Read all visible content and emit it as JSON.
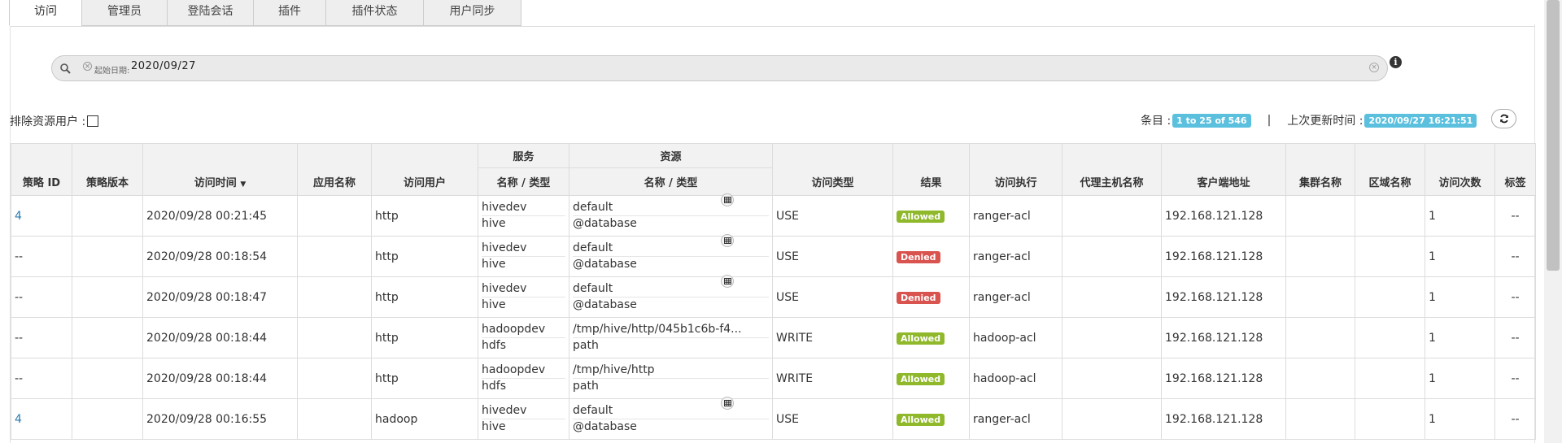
{
  "tabs": [
    "访问",
    "管理员",
    "登陆会话",
    "插件",
    "插件状态",
    "用户同步"
  ],
  "search": {
    "chip_label": "起始日期:",
    "chip_value": "2020/09/27"
  },
  "exclude_label": "排除资源用户 :",
  "counts": {
    "entries_label": "条目 :",
    "entries_value": "1 to 25 of 546",
    "separator": "|",
    "updated_label": "上次更新时间 :",
    "updated_value": "2020/09/27 16:21:51"
  },
  "table": {
    "group_headers": {
      "service": "服务",
      "resource": "资源"
    },
    "headers": {
      "policy_id": "策略 ID",
      "policy_version": "策略版本",
      "access_time": "访问时间",
      "app_name": "应用名称",
      "user": "访问用户",
      "service_sub": "名称 / 类型",
      "resource_sub": "名称 / 类型",
      "access_type": "访问类型",
      "result": "结果",
      "enforcer": "访问执行",
      "agent_host": "代理主机名称",
      "client_ip": "客户端地址",
      "cluster": "集群名称",
      "zone": "区域名称",
      "event_count": "访问次数",
      "tags": "标签"
    },
    "rows": [
      {
        "policy_id": "4",
        "time": "2020/09/28 00:21:45",
        "user": "http",
        "svc_name": "hivedev",
        "svc_type": "hive",
        "res_name": "default",
        "res_type": "@database",
        "has_table_icon": true,
        "access_type": "USE",
        "result": "Allowed",
        "enforcer": "ranger-acl",
        "ip": "192.168.121.128",
        "count": "1",
        "tags": "--"
      },
      {
        "policy_id": "--",
        "time": "2020/09/28 00:18:54",
        "user": "http",
        "svc_name": "hivedev",
        "svc_type": "hive",
        "res_name": "default",
        "res_type": "@database",
        "has_table_icon": true,
        "access_type": "USE",
        "result": "Denied",
        "enforcer": "ranger-acl",
        "ip": "192.168.121.128",
        "count": "1",
        "tags": "--"
      },
      {
        "policy_id": "--",
        "time": "2020/09/28 00:18:47",
        "user": "http",
        "svc_name": "hivedev",
        "svc_type": "hive",
        "res_name": "default",
        "res_type": "@database",
        "has_table_icon": true,
        "access_type": "USE",
        "result": "Denied",
        "enforcer": "ranger-acl",
        "ip": "192.168.121.128",
        "count": "1",
        "tags": "--"
      },
      {
        "policy_id": "--",
        "time": "2020/09/28 00:18:44",
        "user": "http",
        "svc_name": "hadoopdev",
        "svc_type": "hdfs",
        "res_name": "/tmp/hive/http/045b1c6b-f4...",
        "res_type": "path",
        "has_table_icon": false,
        "access_type": "WRITE",
        "result": "Allowed",
        "enforcer": "hadoop-acl",
        "ip": "192.168.121.128",
        "count": "1",
        "tags": "--"
      },
      {
        "policy_id": "--",
        "time": "2020/09/28 00:18:44",
        "user": "http",
        "svc_name": "hadoopdev",
        "svc_type": "hdfs",
        "res_name": "/tmp/hive/http",
        "res_type": "path",
        "has_table_icon": false,
        "access_type": "WRITE",
        "result": "Allowed",
        "enforcer": "hadoop-acl",
        "ip": "192.168.121.128",
        "count": "1",
        "tags": "--"
      },
      {
        "policy_id": "4",
        "time": "2020/09/28 00:16:55",
        "user": "hadoop",
        "svc_name": "hivedev",
        "svc_type": "hive",
        "res_name": "default",
        "res_type": "@database",
        "has_table_icon": true,
        "access_type": "USE",
        "result": "Allowed",
        "enforcer": "ranger-acl",
        "ip": "192.168.121.128",
        "count": "1",
        "tags": "--"
      }
    ]
  },
  "colors": {
    "allowed": "#8fb82a",
    "denied": "#d9534f",
    "badge": "#5bc0de",
    "link": "#2a7ab0"
  },
  "icons": {
    "search": "search-icon",
    "info": "info-icon",
    "refresh": "refresh-icon",
    "table": "table-icon",
    "sort": "caret-down-icon"
  }
}
